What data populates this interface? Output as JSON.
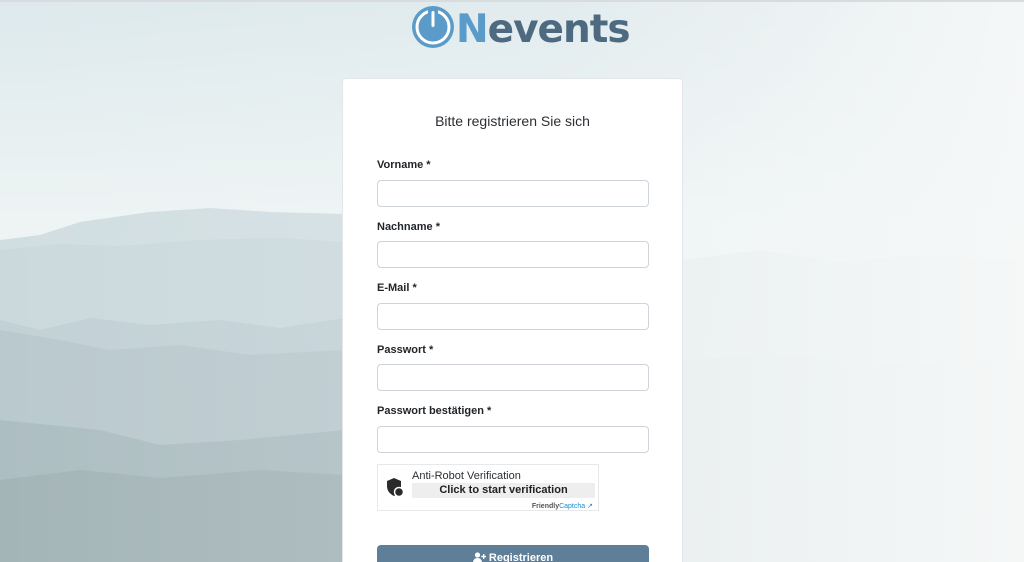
{
  "brand": {
    "logo_letter": "N",
    "logo_rest": "events",
    "colors": {
      "dark": "#4e6a80",
      "light": "#5b9bc9"
    },
    "icon": "power-icon"
  },
  "form": {
    "title": "Bitte registrieren Sie sich",
    "fields": [
      {
        "label": "Vorname *",
        "value": "",
        "placeholder": ""
      },
      {
        "label": "Nachname *",
        "value": "",
        "placeholder": ""
      },
      {
        "label": "E-Mail *",
        "value": "",
        "placeholder": ""
      },
      {
        "label": "Passwort *",
        "value": "",
        "placeholder": ""
      },
      {
        "label": "Passwort bestätigen *",
        "value": "",
        "placeholder": ""
      }
    ],
    "captcha": {
      "title": "Anti-Robot Verification",
      "button": "Click to start verification",
      "brand_a": "Friendly",
      "brand_b": "Captcha",
      "brand_arrow": "↗",
      "icon": "shield-icon"
    },
    "submit": {
      "label": "Registrieren",
      "icon": "user-plus-icon",
      "color": "#5f7f99"
    }
  }
}
